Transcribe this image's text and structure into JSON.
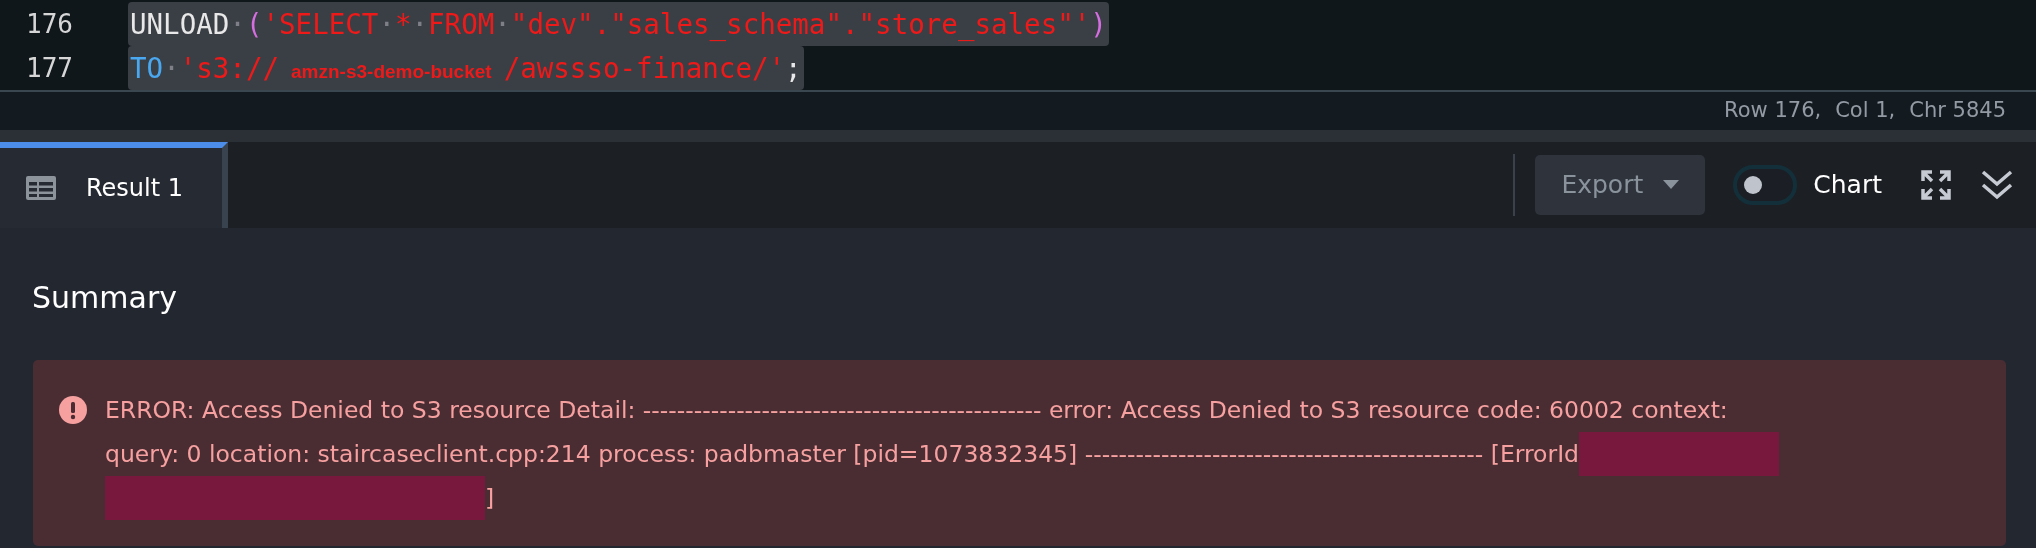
{
  "editor": {
    "lines": [
      {
        "number": "176",
        "selected": true,
        "tokens": [
          {
            "kind": "plain",
            "text": "UNLOAD"
          },
          {
            "kind": "space",
            "text": "·"
          },
          {
            "kind": "paren",
            "text": "("
          },
          {
            "kind": "string",
            "text": "'SELECT"
          },
          {
            "kind": "space",
            "text": "·"
          },
          {
            "kind": "string",
            "text": "*"
          },
          {
            "kind": "space",
            "text": "·"
          },
          {
            "kind": "string",
            "text": "FROM"
          },
          {
            "kind": "space",
            "text": "·"
          },
          {
            "kind": "string",
            "text": "\"dev\".\"sales_schema\".\"store_sales\"'"
          },
          {
            "kind": "paren",
            "text": ")"
          }
        ]
      },
      {
        "number": "177",
        "selected": true,
        "tokens": [
          {
            "kind": "keyword",
            "text": "TO"
          },
          {
            "kind": "space",
            "text": "·"
          },
          {
            "kind": "string",
            "text": "'s3://"
          },
          {
            "kind": "label",
            "text": "amzn-s3-demo-bucket"
          },
          {
            "kind": "string",
            "text": "/awssso-finance/'"
          },
          {
            "kind": "plain",
            "text": ";"
          }
        ]
      }
    ]
  },
  "status_bar": [
    "Row 176,",
    "Col 1,",
    "Chr 5845"
  ],
  "tabs": [
    {
      "label": "Result 1",
      "selected": true
    }
  ],
  "toolbar": {
    "export": {
      "label": "Export",
      "disabled": true
    },
    "chart": {
      "label": "Chart",
      "on": false
    }
  },
  "summary": {
    "title": "Summary",
    "error": {
      "lines": [
        "ERROR: Access Denied to S3 resource Detail: ----------------------------------------------- error: Access Denied to S3 resource code: 60002 context:",
        "query: 0 location: staircaseclient.cpp:214 process: padbmaster [pid=1073832345] ----------------------------------------------- [ErrorId"
      ],
      "closing": "]"
    }
  }
}
